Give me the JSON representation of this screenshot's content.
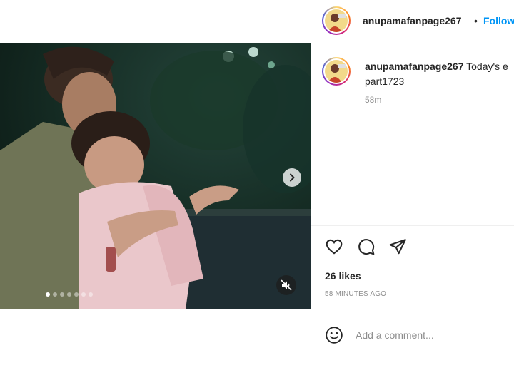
{
  "post": {
    "username": "anupamafanpage267",
    "follow_label": "Follow",
    "separator": "•",
    "caption_text": "Today's e",
    "caption_tag": "part1723",
    "caption_time": "58m",
    "likes": "26 likes",
    "timestamp": "58 MINUTES AGO",
    "comment_placeholder": "Add a comment..."
  },
  "media": {
    "carousel_count": 7,
    "carousel_active": 1
  },
  "icons": {
    "like": "heart-icon",
    "comment": "comment-icon",
    "share": "paper-plane-icon",
    "next": "chevron-right-icon",
    "mute": "muted-speaker-icon",
    "emoji": "smiley-icon"
  },
  "colors": {
    "accent": "#0095f6",
    "muted_text": "#8e8e8e",
    "border": "#efefef"
  }
}
